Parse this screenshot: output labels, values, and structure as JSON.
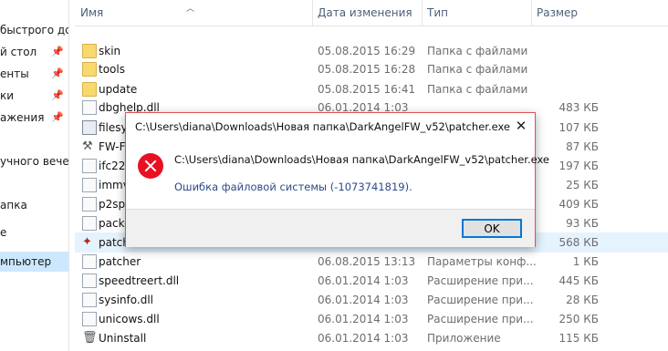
{
  "nav": {
    "items": [
      {
        "label": "быстрого дс",
        "pinned": false
      },
      {
        "label": "й стол",
        "pinned": true
      },
      {
        "label": "енты",
        "pinned": true
      },
      {
        "label": "ки",
        "pinned": true
      },
      {
        "label": "ажения",
        "pinned": true
      },
      {
        "label": "учного вече",
        "pinned": false
      },
      {
        "label": "апка",
        "pinned": false
      },
      {
        "label": "е",
        "pinned": false
      },
      {
        "label": "мпьютер",
        "pinned": false
      }
    ]
  },
  "columns": {
    "name": "Имя",
    "date": "Дата изменения",
    "type": "Тип",
    "size": "Размер"
  },
  "files": [
    {
      "name": "skin",
      "date": "05.08.2015 16:29",
      "type": "Папка с файлами",
      "size": "",
      "icon": "folder-icon"
    },
    {
      "name": "tools",
      "date": "05.08.2015 16:28",
      "type": "Папка с файлами",
      "size": "",
      "icon": "folder-icon"
    },
    {
      "name": "update",
      "date": "05.08.2015 16:41",
      "type": "Папка с файлами",
      "size": "",
      "icon": "folder-icon"
    },
    {
      "name": "dbghelp.dll",
      "date": "06.01.2014 1:03",
      "type": "",
      "size": "483 КБ",
      "icon": "dll-file-icon"
    },
    {
      "name": "filesym",
      "date": "",
      "type": "",
      "size": "107 КБ",
      "icon": "exe-file-icon"
    },
    {
      "name": "FW-Fi",
      "date": "",
      "type": "",
      "size": "87 КБ",
      "icon": "tool-icon"
    },
    {
      "name": "ifc22.d",
      "date": "",
      "type": "",
      "size": "197 КБ",
      "icon": "dll-file-icon"
    },
    {
      "name": "immv",
      "date": "",
      "type": "",
      "size": "25 КБ",
      "icon": "dll-file-icon"
    },
    {
      "name": "p2sp_",
      "date": "",
      "type": "",
      "size": "409 КБ",
      "icon": "dll-file-icon"
    },
    {
      "name": "packo",
      "date": "",
      "type": "",
      "size": "93 КБ",
      "icon": "dll-file-icon"
    },
    {
      "name": "patch",
      "date": "",
      "type": "",
      "size": "568 КБ",
      "icon": "patcher-icon"
    },
    {
      "name": "patcher",
      "date": "06.08.2015 13:13",
      "type": "Параметры конф...",
      "size": "1 КБ",
      "icon": "config-file-icon"
    },
    {
      "name": "speedtreert.dll",
      "date": "06.01.2014 1:03",
      "type": "Расширение при...",
      "size": "445 КБ",
      "icon": "dll-file-icon"
    },
    {
      "name": "sysinfo.dll",
      "date": "06.01.2014 1:03",
      "type": "Расширение при...",
      "size": "28 КБ",
      "icon": "dll-file-icon"
    },
    {
      "name": "unicows.dll",
      "date": "06.01.2014 1:03",
      "type": "Расширение при...",
      "size": "250 КБ",
      "icon": "dll-file-icon"
    },
    {
      "name": "Uninstall",
      "date": "06.01.2014 1:03",
      "type": "Приложение",
      "size": "115 КБ",
      "icon": "uninstall-icon"
    }
  ],
  "dialog": {
    "title": "C:\\Users\\diana\\Downloads\\Новая папка\\DarkAngelFW_v52\\patcher.exe",
    "path": "C:\\Users\\diana\\Downloads\\Новая папка\\DarkAngelFW_v52\\patcher.exe",
    "message": "Ошибка файловой системы (-1073741819).",
    "ok_label": "OK",
    "close_glyph": "✕"
  }
}
